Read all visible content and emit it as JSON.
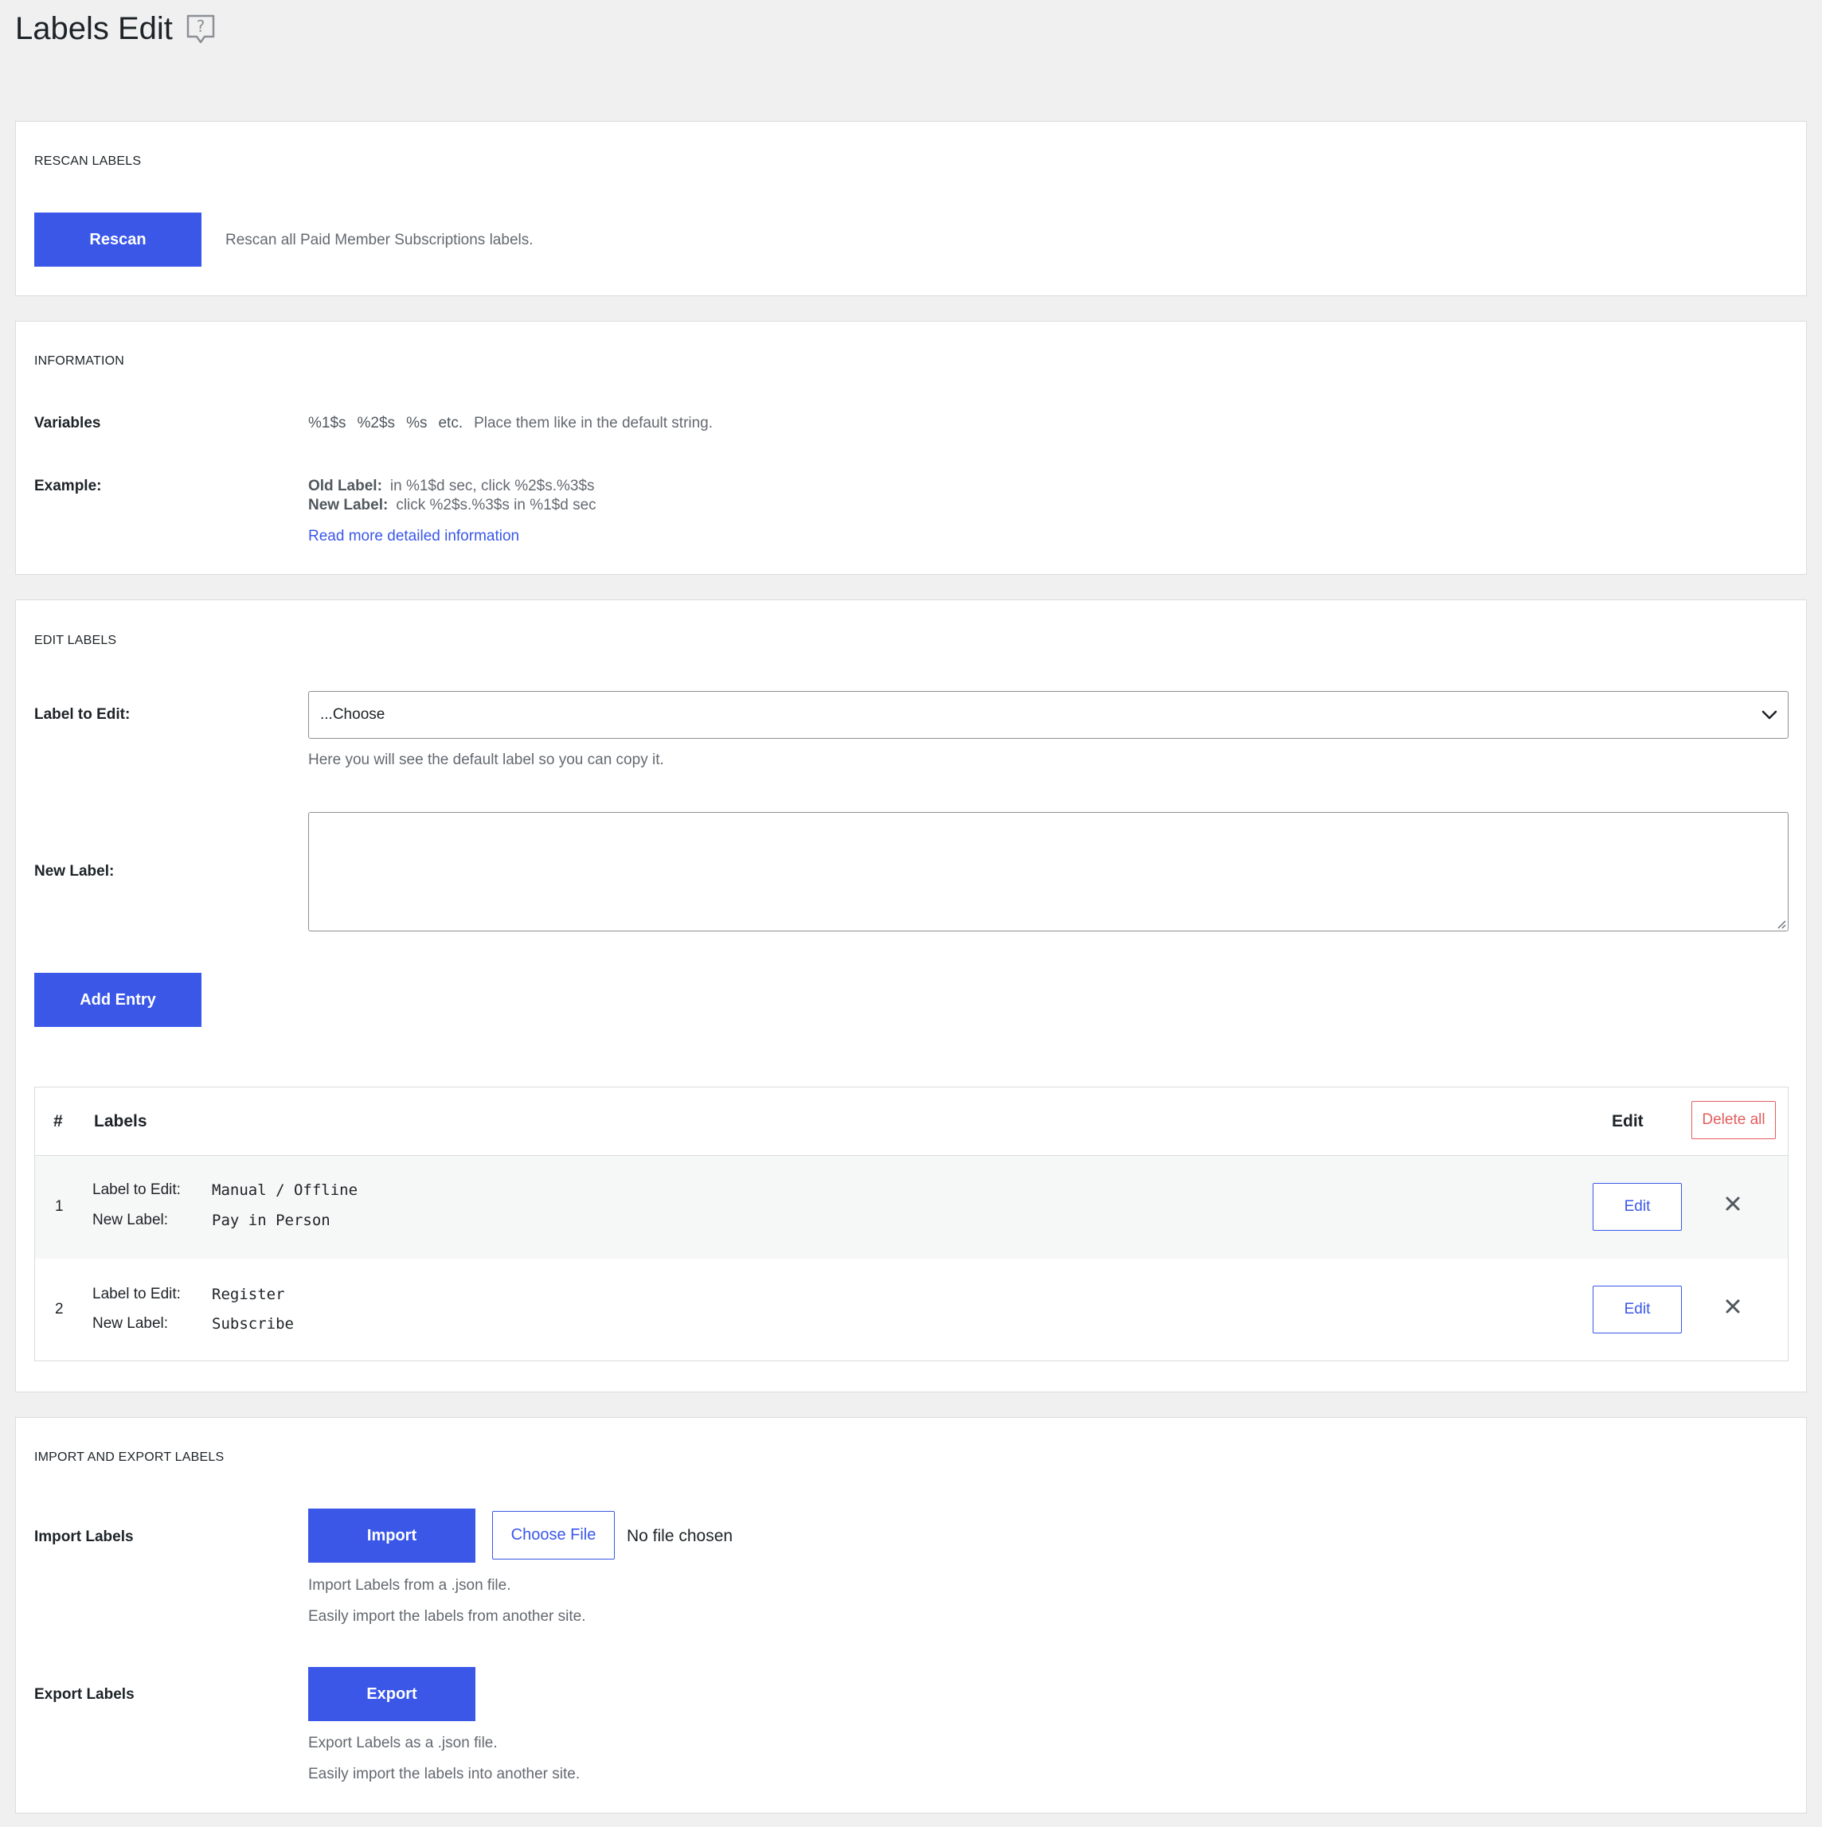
{
  "page": {
    "title": "Labels Edit"
  },
  "icons": {
    "help": "help-question-icon",
    "chevron": "chevron-down-icon",
    "close": "close-x-icon"
  },
  "colors": {
    "primary": "#3a57e8",
    "danger": "#e35d5d",
    "background": "#f0f0f1"
  },
  "rescan": {
    "section_title": "RESCAN LABELS",
    "button_label": "Rescan",
    "description": "Rescan all Paid Member Subscriptions labels."
  },
  "information": {
    "section_title": "INFORMATION",
    "variables_label": "Variables",
    "variables": [
      "%1$s",
      "%2$s",
      "%s",
      "etc."
    ],
    "variables_note": "Place them like in the default string.",
    "example_label": "Example:",
    "old_label_key": "Old Label:",
    "old_label_value": "in %1$d sec, click %2$s.%3$s",
    "new_label_key": "New Label:",
    "new_label_value": "click %2$s.%3$s in %1$d sec",
    "read_more_link": "Read more detailed information"
  },
  "edit_labels": {
    "section_title": "EDIT LABELS",
    "label_to_edit_label": "Label to Edit:",
    "select_value": "...Choose",
    "select_help": "Here you will see the default label so you can copy it.",
    "new_label_label": "New Label:",
    "new_label_value": "",
    "add_entry_button": "Add Entry",
    "table": {
      "col_number": "#",
      "col_labels": "Labels",
      "col_edit": "Edit",
      "delete_all": "Delete all",
      "row_key_label": "Label to Edit:",
      "row_key_new": "New Label:",
      "edit_button": "Edit",
      "rows": [
        {
          "num": "1",
          "label_to_edit": "Manual / Offline",
          "new_label": "Pay in Person"
        },
        {
          "num": "2",
          "label_to_edit": "Register",
          "new_label": "Subscribe"
        }
      ]
    }
  },
  "import_export": {
    "section_title": "IMPORT AND EXPORT LABELS",
    "import_label": "Import Labels",
    "import_button": "Import",
    "choose_file_button": "Choose File",
    "file_status": "No file chosen",
    "import_help_1": "Import Labels from a .json file.",
    "import_help_2": "Easily import the labels from another site.",
    "export_label": "Export Labels",
    "export_button": "Export",
    "export_help_1": "Export Labels as a .json file.",
    "export_help_2": "Easily import the labels into another site."
  }
}
